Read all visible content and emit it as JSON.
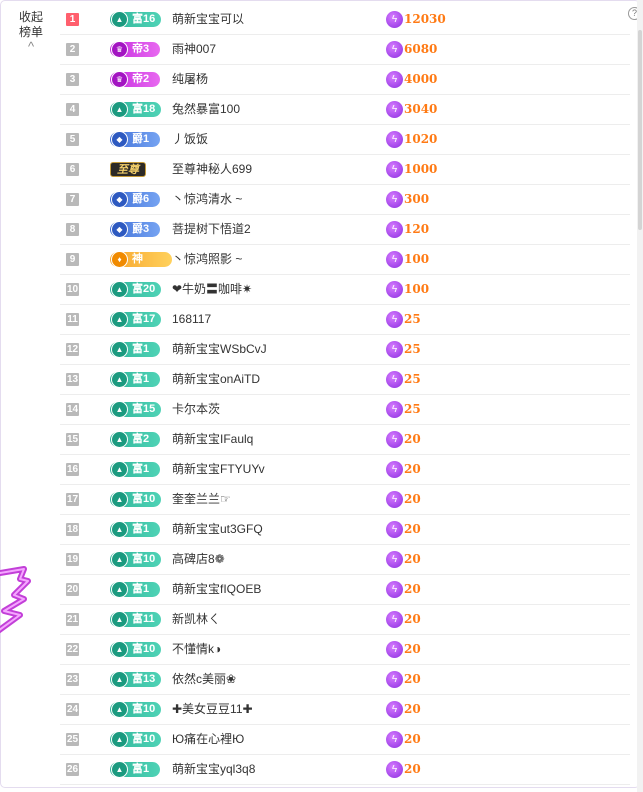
{
  "panel": {
    "collapse_line1": "收起",
    "collapse_line2": "榜单",
    "chevron": "^",
    "help": "?"
  },
  "icons": {
    "badge_fu": "triangle-icon",
    "badge_di": "crown-icon",
    "badge_jue": "diamond-icon",
    "score": "lightning-bolt-icon"
  },
  "colors": {
    "rank_top": "#ff5f6d",
    "rank_default": "#b9b9b9",
    "score_text": "#ff7a14",
    "fu": "#2fb59a",
    "di": "#c52be0",
    "jue": "#3f6fd8"
  },
  "rows": [
    {
      "rank": "1",
      "badge_type": "fu",
      "badge": "富16",
      "name": "萌新宝宝可以",
      "score": "12030"
    },
    {
      "rank": "2",
      "badge_type": "di",
      "badge": "帝3",
      "name": "雨神007",
      "score": "6080"
    },
    {
      "rank": "3",
      "badge_type": "di",
      "badge": "帝2",
      "name": "纯屠杨",
      "score": "4000"
    },
    {
      "rank": "4",
      "badge_type": "fu",
      "badge": "富18",
      "name": "兔然暴富100",
      "score": "3040"
    },
    {
      "rank": "5",
      "badge_type": "jue",
      "badge": "爵1",
      "name": "丿饭饭",
      "score": "1020"
    },
    {
      "rank": "6",
      "badge_type": "zhi",
      "badge": "至尊",
      "name": "至尊神秘人699",
      "score": "1000"
    },
    {
      "rank": "7",
      "badge_type": "jue",
      "badge": "爵6",
      "name": "丶惊鸿清水 ~",
      "score": "300"
    },
    {
      "rank": "8",
      "badge_type": "jue",
      "badge": "爵3",
      "name": "菩提树下悟道2",
      "score": "120"
    },
    {
      "rank": "9",
      "badge_type": "shen",
      "badge": "神",
      "name": "丶惊鸿照影 ~",
      "score": "100"
    },
    {
      "rank": "10",
      "badge_type": "fu",
      "badge": "富20",
      "name": "❤牛奶〓咖啡✷",
      "score": "100"
    },
    {
      "rank": "11",
      "badge_type": "fu",
      "badge": "富17",
      "name": "168117",
      "score": "25"
    },
    {
      "rank": "12",
      "badge_type": "fu",
      "badge": "富1",
      "name": "萌新宝宝WSbCvJ",
      "score": "25"
    },
    {
      "rank": "13",
      "badge_type": "fu",
      "badge": "富1",
      "name": "萌新宝宝onAiTD",
      "score": "25"
    },
    {
      "rank": "14",
      "badge_type": "fu",
      "badge": "富15",
      "name": "卡尔本茨",
      "score": "25"
    },
    {
      "rank": "15",
      "badge_type": "fu",
      "badge": "富2",
      "name": "萌新宝宝IFaulq",
      "score": "20"
    },
    {
      "rank": "16",
      "badge_type": "fu",
      "badge": "富1",
      "name": "萌新宝宝FTYUYv",
      "score": "20"
    },
    {
      "rank": "17",
      "badge_type": "fu",
      "badge": "富10",
      "name": "奎奎兰兰☞",
      "score": "20"
    },
    {
      "rank": "18",
      "badge_type": "fu",
      "badge": "富1",
      "name": "萌新宝宝ut3GFQ",
      "score": "20"
    },
    {
      "rank": "19",
      "badge_type": "fu",
      "badge": "富10",
      "name": "高碑店8❁",
      "score": "20"
    },
    {
      "rank": "20",
      "badge_type": "fu",
      "badge": "富1",
      "name": "萌新宝宝fIQOEB",
      "score": "20"
    },
    {
      "rank": "21",
      "badge_type": "fu",
      "badge": "富11",
      "name": "新凯林ㄑ",
      "score": "20"
    },
    {
      "rank": "22",
      "badge_type": "fu",
      "badge": "富10",
      "name": "不懂情k◑",
      "score": "20"
    },
    {
      "rank": "23",
      "badge_type": "fu",
      "badge": "富13",
      "name": "依然c美丽❀",
      "score": "20"
    },
    {
      "rank": "24",
      "badge_type": "fu",
      "badge": "富10",
      "name": "✚美女豆豆11✚",
      "score": "20"
    },
    {
      "rank": "25",
      "badge_type": "fu",
      "badge": "富10",
      "name": "Ю痛在心裡Ю",
      "score": "20"
    },
    {
      "rank": "26",
      "badge_type": "fu",
      "badge": "富1",
      "name": "萌新宝宝yql3q8",
      "score": "20"
    }
  ]
}
